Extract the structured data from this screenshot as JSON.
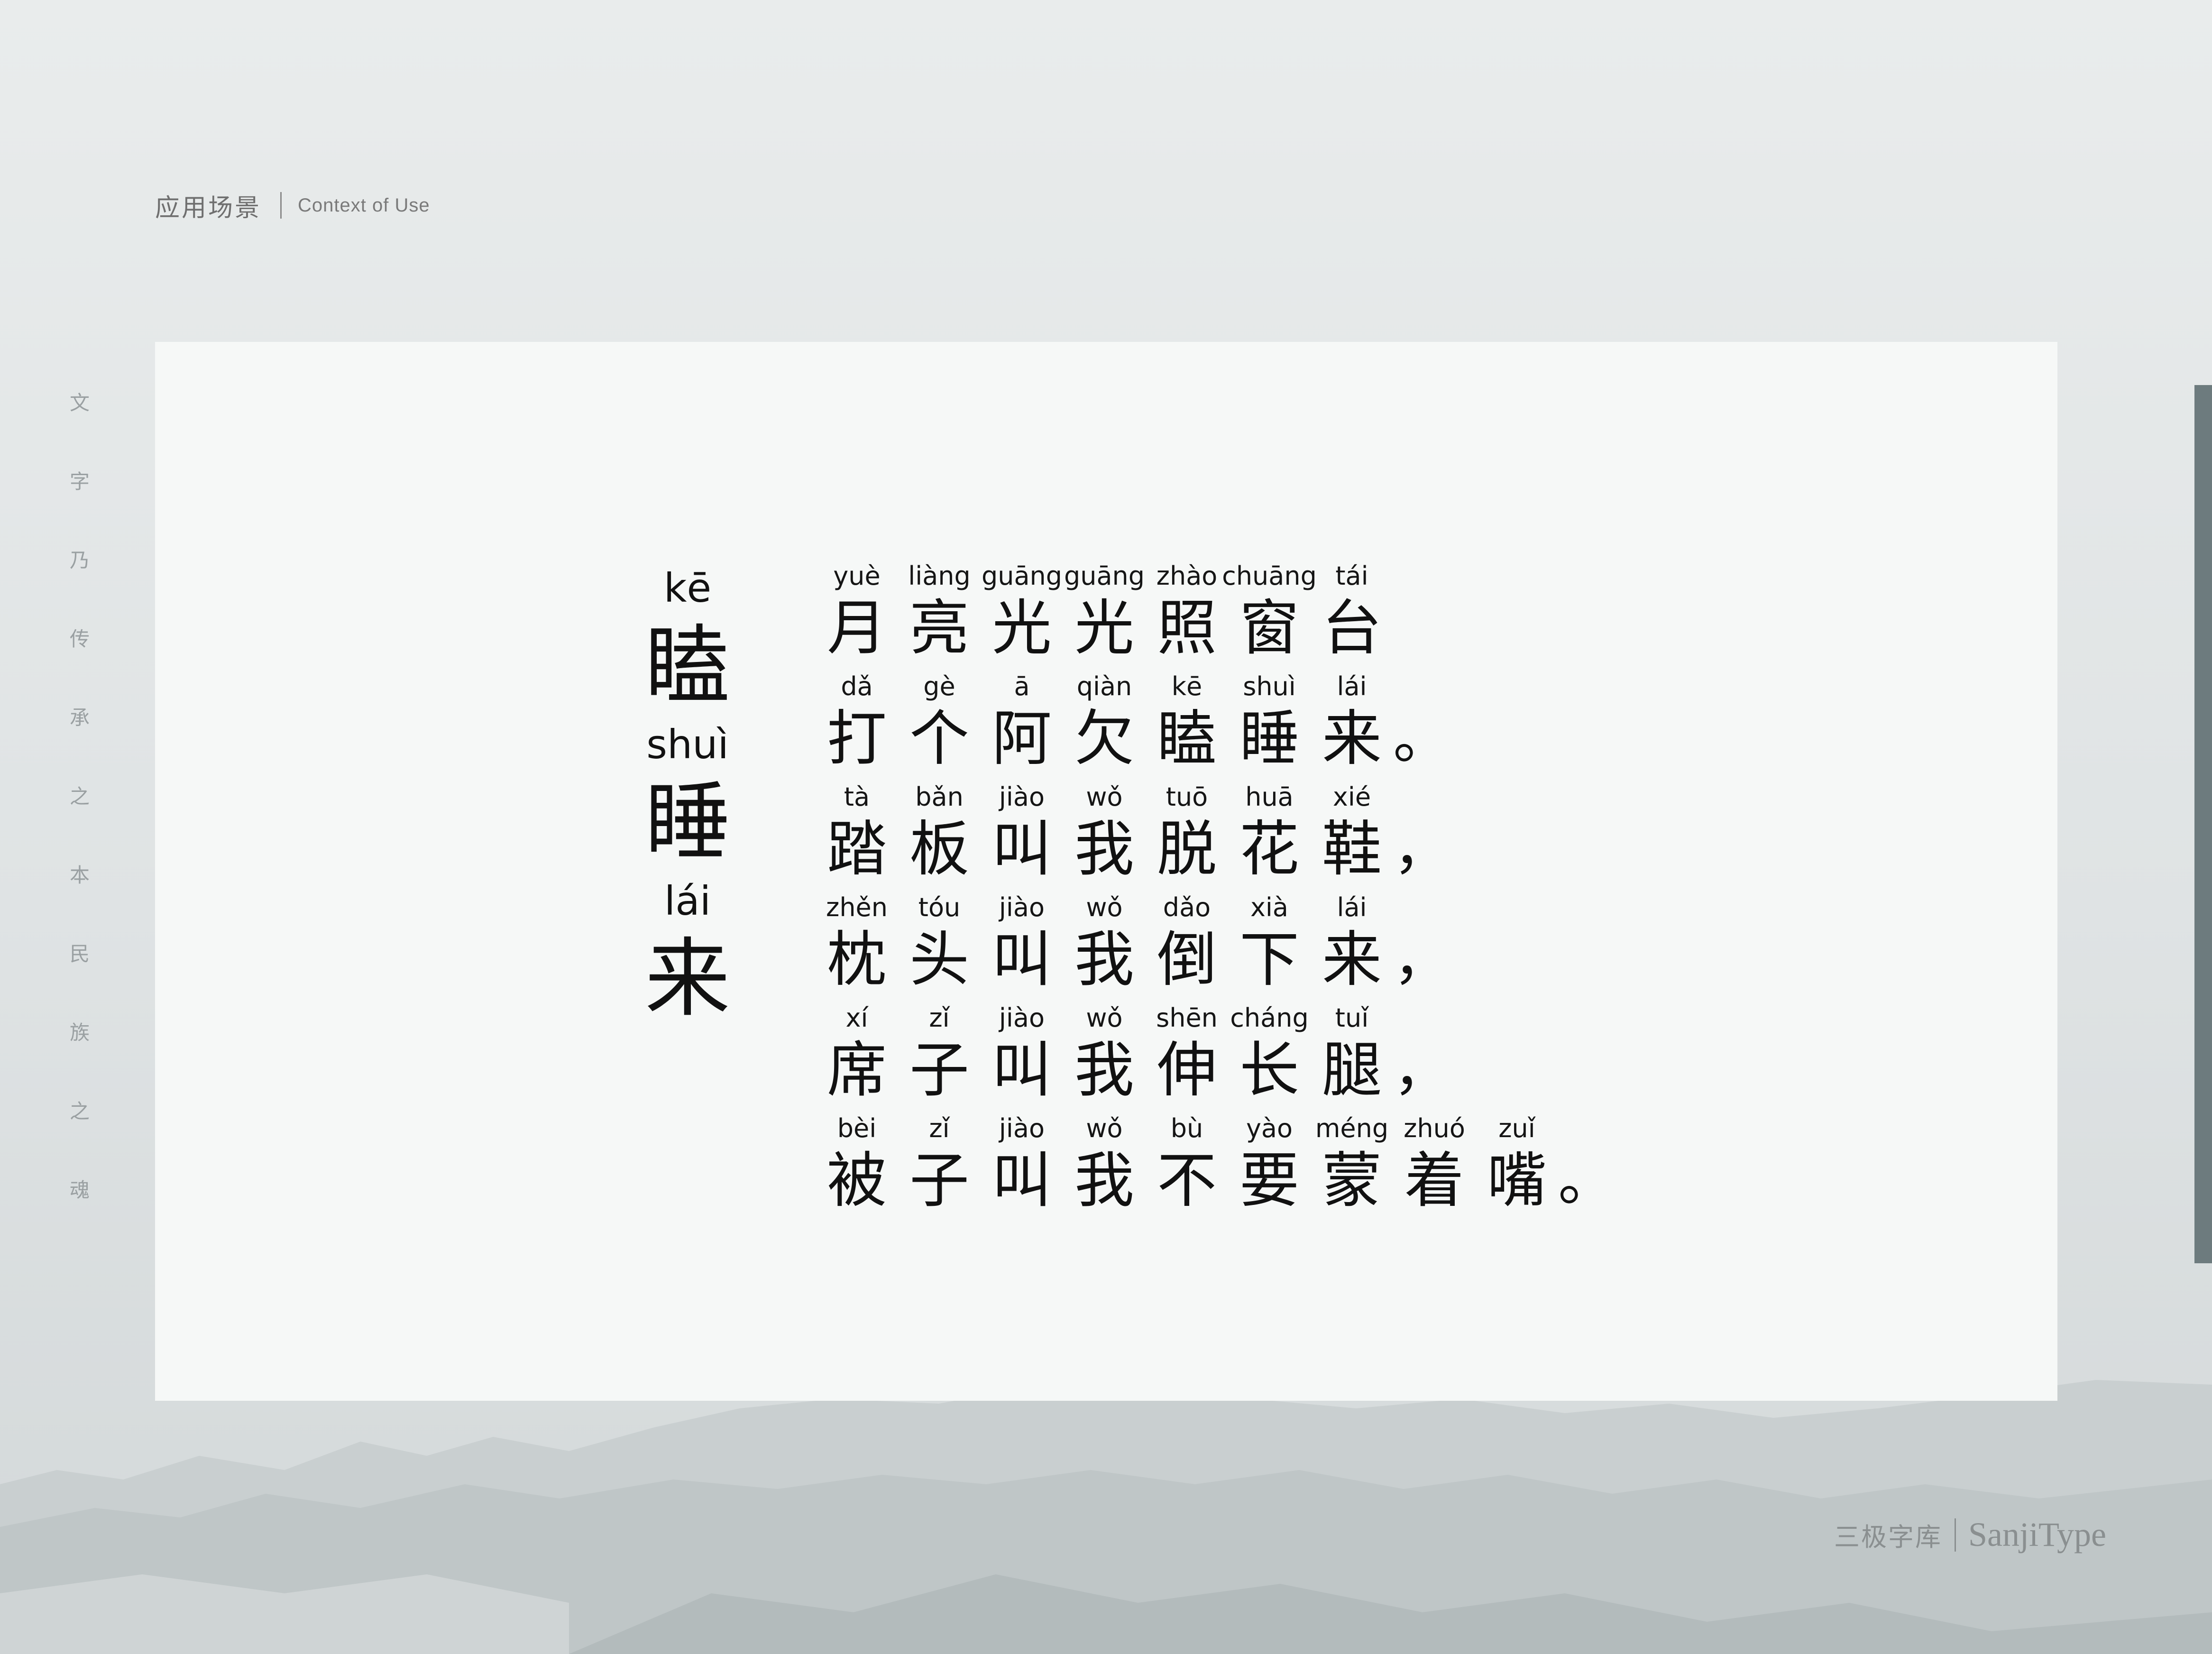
{
  "header": {
    "title_zh": "应用场景",
    "title_en": "Context of Use"
  },
  "vertical_text": [
    "文",
    "字",
    "乃",
    "传",
    "承",
    "之",
    "本",
    "民",
    "族",
    "之",
    "魂"
  ],
  "title": [
    {
      "pinyin": "kē",
      "char": "瞌"
    },
    {
      "pinyin": "shuì",
      "char": "睡"
    },
    {
      "pinyin": "lái",
      "char": "来"
    }
  ],
  "poem": [
    {
      "chars": [
        {
          "py": "yuè",
          "ch": "月"
        },
        {
          "py": "liàng",
          "ch": "亮"
        },
        {
          "py": "guāng",
          "ch": "光"
        },
        {
          "py": "guāng",
          "ch": "光"
        },
        {
          "py": "zhào",
          "ch": "照"
        },
        {
          "py": "chuāng",
          "ch": "窗"
        },
        {
          "py": "tái",
          "ch": "台"
        }
      ],
      "punct": ""
    },
    {
      "chars": [
        {
          "py": "dǎ",
          "ch": "打"
        },
        {
          "py": "gè",
          "ch": "个"
        },
        {
          "py": "ā",
          "ch": "阿"
        },
        {
          "py": "qiàn",
          "ch": "欠"
        },
        {
          "py": "kē",
          "ch": "瞌"
        },
        {
          "py": "shuì",
          "ch": "睡"
        },
        {
          "py": "lái",
          "ch": "来"
        }
      ],
      "punct": "。"
    },
    {
      "chars": [
        {
          "py": "tà",
          "ch": "踏"
        },
        {
          "py": "bǎn",
          "ch": "板"
        },
        {
          "py": "jiào",
          "ch": "叫"
        },
        {
          "py": "wǒ",
          "ch": "我"
        },
        {
          "py": "tuō",
          "ch": "脱"
        },
        {
          "py": "huā",
          "ch": "花"
        },
        {
          "py": "xié",
          "ch": "鞋"
        }
      ],
      "punct": "，"
    },
    {
      "chars": [
        {
          "py": "zhěn",
          "ch": "枕"
        },
        {
          "py": "tóu",
          "ch": "头"
        },
        {
          "py": "jiào",
          "ch": "叫"
        },
        {
          "py": "wǒ",
          "ch": "我"
        },
        {
          "py": "dǎo",
          "ch": "倒"
        },
        {
          "py": "xià",
          "ch": "下"
        },
        {
          "py": "lái",
          "ch": "来"
        }
      ],
      "punct": "，"
    },
    {
      "chars": [
        {
          "py": "xí",
          "ch": "席"
        },
        {
          "py": "zǐ",
          "ch": "子"
        },
        {
          "py": "jiào",
          "ch": "叫"
        },
        {
          "py": "wǒ",
          "ch": "我"
        },
        {
          "py": "shēn",
          "ch": "伸"
        },
        {
          "py": "cháng",
          "ch": "长"
        },
        {
          "py": "tuǐ",
          "ch": "腿"
        }
      ],
      "punct": "，"
    },
    {
      "chars": [
        {
          "py": "bèi",
          "ch": "被"
        },
        {
          "py": "zǐ",
          "ch": "子"
        },
        {
          "py": "jiào",
          "ch": "叫"
        },
        {
          "py": "wǒ",
          "ch": "我"
        },
        {
          "py": "bù",
          "ch": "不"
        },
        {
          "py": "yào",
          "ch": "要"
        },
        {
          "py": "méng",
          "ch": "蒙"
        },
        {
          "py": "zhuó",
          "ch": "着"
        },
        {
          "py": "zuǐ",
          "ch": "嘴"
        }
      ],
      "punct": "。"
    }
  ],
  "brand": {
    "zh": "三极字库",
    "en": "SanjiType"
  },
  "colors": {
    "background": "#e3e7e8",
    "card": "#f6f8f7",
    "side_bar": "#6d7b7e",
    "text": "#111111",
    "muted": "#8a8f90"
  }
}
